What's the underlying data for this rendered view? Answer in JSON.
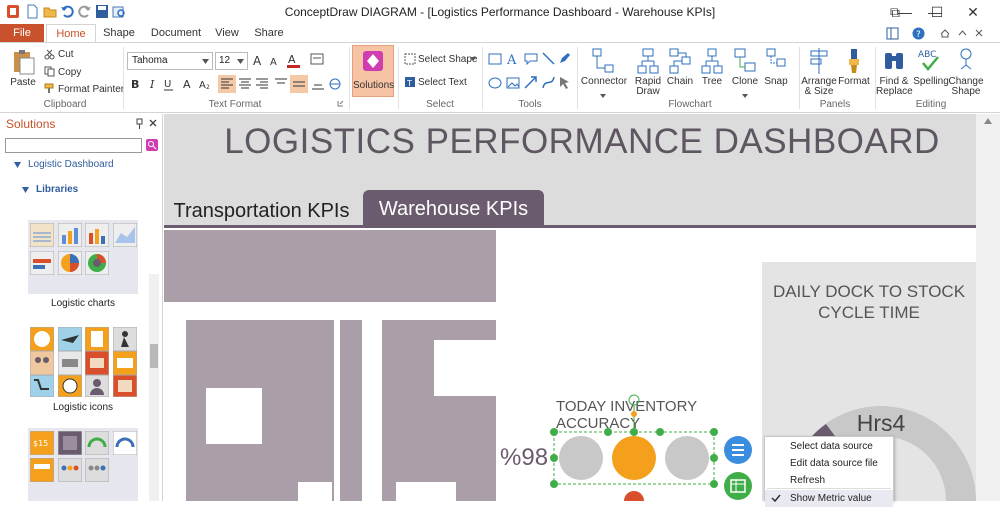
{
  "window": {
    "title": "ConceptDraw DIAGRAM - [Logistics Performance Dashboard - Warehouse KPIs]",
    "minimize_glyph": "—",
    "maximize_glyph": "☐",
    "close_glyph": "✕",
    "restore_glyph": "⧉"
  },
  "menu_tabs": {
    "file": "File",
    "home": "Home",
    "shape": "Shape",
    "document": "Document",
    "view": "View",
    "share": "Share"
  },
  "ribbon": {
    "clipboard": {
      "paste": "Paste",
      "cut": "Cut",
      "copy": "Copy",
      "format_painter": "Format Painter",
      "group": "Clipboard"
    },
    "text_format": {
      "font": "Tahoma",
      "size": "12",
      "group": "Text Format"
    },
    "solutions": {
      "label": "Solutions"
    },
    "select": {
      "select_shape": "Select Shape",
      "select_text": "Select Text",
      "group": "Select"
    },
    "tools": {
      "group": "Tools"
    },
    "flowchart": {
      "connector": "Connector",
      "rapid_draw": "Rapid\nDraw",
      "chain": "Chain",
      "tree": "Tree",
      "clone": "Clone",
      "snap": "Snap",
      "group": "Flowchart"
    },
    "panels": {
      "arrange": "Arrange\n& Size",
      "format": "Format",
      "group": "Panels"
    },
    "editing": {
      "find_replace": "Find &\nReplace",
      "spelling": "Spelling",
      "change_shape": "Change\nShape",
      "group": "Editing"
    }
  },
  "solutions_panel": {
    "title": "Solutions",
    "search_placeholder": "",
    "tree_item": "Logistic Dashboard",
    "libraries": "Libraries",
    "library_1": "Logistic charts",
    "library_2": "Logistic icons"
  },
  "dashboard": {
    "title": "LOGISTICS PERFORMANCE DASHBOARD",
    "tab_transport": "Transportation KPIs",
    "tab_warehouse": "Warehouse KPIs",
    "daily_dock_line1": "DAILY DOCK TO STOCK",
    "daily_dock_line2": "CYCLE TIME",
    "dock_value": "Hrs4",
    "inventory_line1": "TODAY INVENTORY",
    "inventory_line2": "ACCURACY",
    "inventory_value": "%98"
  },
  "context_menu": {
    "items": [
      "Select data source",
      "Edit data source file",
      "Refresh",
      "Show Metric value"
    ]
  },
  "colors": {
    "file_tab": "#c9512b",
    "accent_purple": "#6b5b6e",
    "light_mauve": "#a99da6",
    "orange": "#f5a01d",
    "gray_circle": "#c8c8c8",
    "blue_button": "#3b8de0",
    "green_button": "#3fae49"
  }
}
